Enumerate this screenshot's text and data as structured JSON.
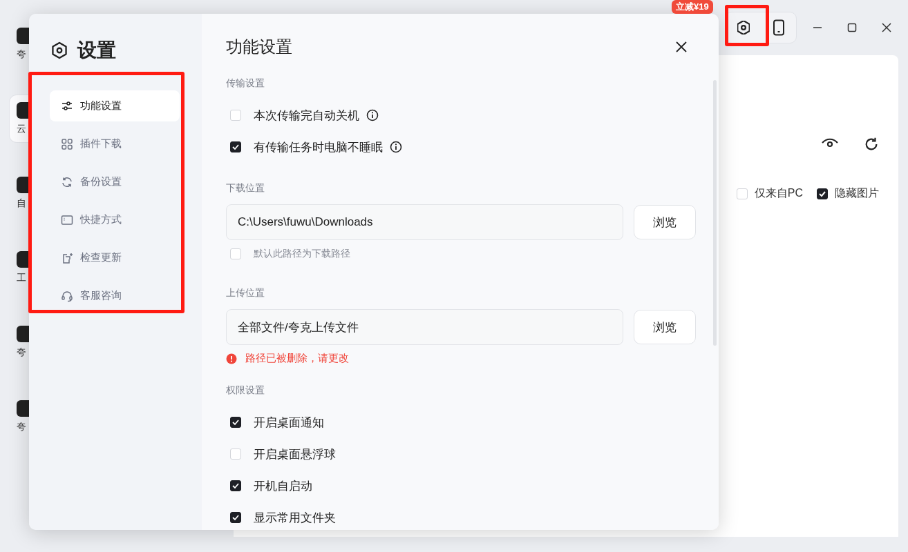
{
  "app": {
    "rail": [
      {
        "label": "夸",
        "selected": false
      },
      {
        "label": "云",
        "selected": true
      },
      {
        "label": "自",
        "selected": false
      },
      {
        "label": "工",
        "selected": false
      },
      {
        "label": "夸",
        "selected": false
      },
      {
        "label": "夸",
        "selected": false
      }
    ],
    "badge": "立减¥19",
    "filters": [
      {
        "label": "仅来自PC",
        "checked": false
      },
      {
        "label": "隐藏图片",
        "checked": true
      }
    ]
  },
  "dialog": {
    "title": "设置",
    "heading": "功能设置",
    "nav": [
      {
        "label": "功能设置",
        "selected": true
      },
      {
        "label": "插件下载",
        "selected": false
      },
      {
        "label": "备份设置",
        "selected": false
      },
      {
        "label": "快捷方式",
        "selected": false
      },
      {
        "label": "检查更新",
        "selected": false
      },
      {
        "label": "客服咨询",
        "selected": false
      }
    ],
    "sections": [
      {
        "title": "传输设置",
        "items": [
          {
            "kind": "checkbox",
            "label": "本次传输完自动关机",
            "checked": false,
            "info": true
          },
          {
            "kind": "checkbox",
            "label": "有传输任务时电脑不睡眠",
            "checked": true,
            "info": true
          }
        ]
      },
      {
        "title": "下载位置",
        "items": [
          {
            "kind": "path",
            "value": "C:\\Users\\fuwu\\Downloads",
            "button": "浏览"
          },
          {
            "kind": "subcheck",
            "label": "默认此路径为下载路径",
            "checked": false
          }
        ]
      },
      {
        "title": "上传位置",
        "items": [
          {
            "kind": "path",
            "value": "全部文件/夸克上传文件",
            "button": "浏览"
          },
          {
            "kind": "error",
            "text": "路径已被删除，请更改"
          }
        ]
      },
      {
        "title": "权限设置",
        "items": [
          {
            "kind": "checkbox",
            "label": "开启桌面通知",
            "checked": true
          },
          {
            "kind": "checkbox",
            "label": "开启桌面悬浮球",
            "checked": false
          },
          {
            "kind": "checkbox",
            "label": "开机自启动",
            "checked": true
          },
          {
            "kind": "checkbox",
            "label": "显示常用文件夹",
            "checked": true
          }
        ]
      }
    ]
  }
}
